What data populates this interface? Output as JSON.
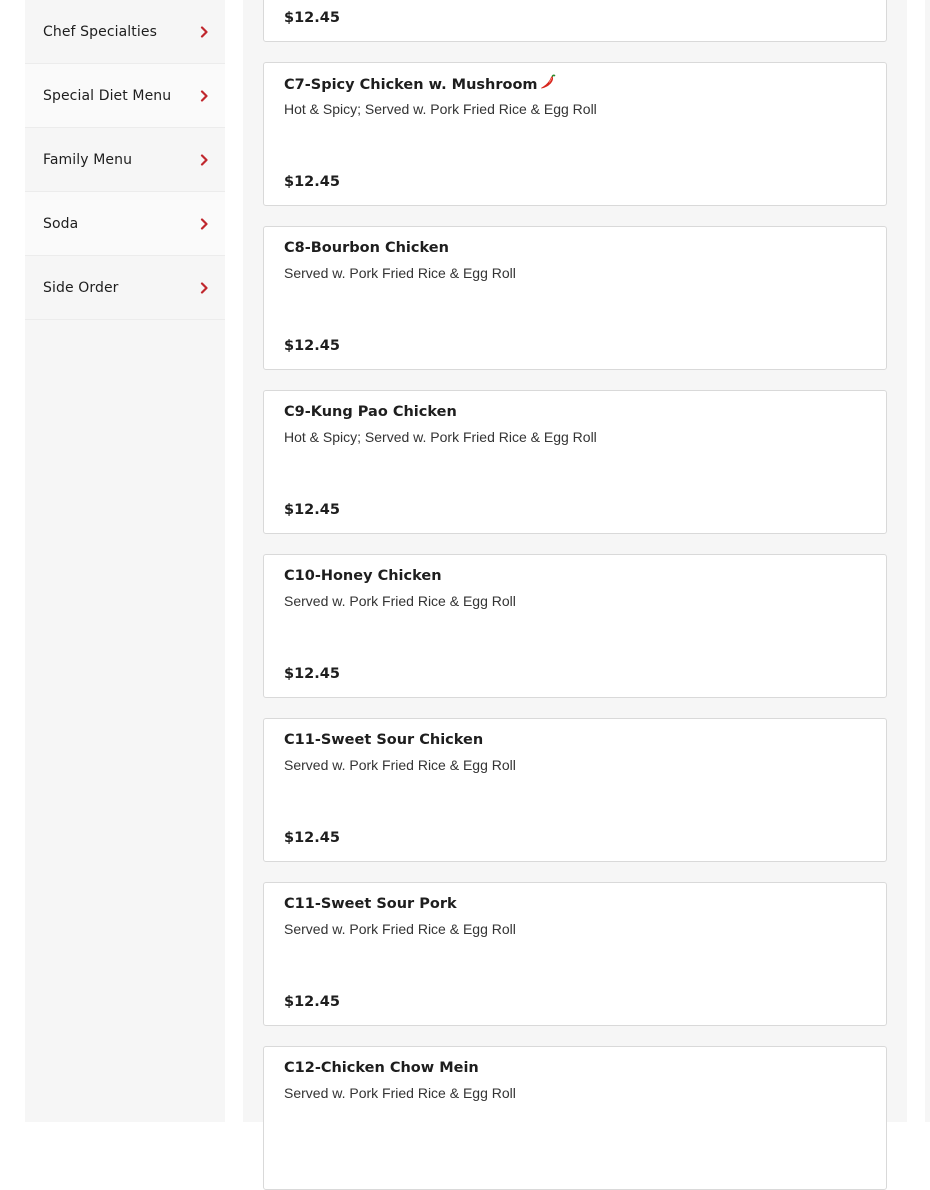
{
  "sidebar": {
    "items": [
      {
        "label": "Chef Specialties"
      },
      {
        "label": "Special Diet Menu"
      },
      {
        "label": "Family Menu"
      },
      {
        "label": "Soda"
      },
      {
        "label": "Side Order"
      }
    ]
  },
  "menu": {
    "top_partial_price": "$12.45",
    "items": [
      {
        "name": "C7-Spicy Chicken w. Mushroom",
        "desc": "Hot & Spicy; Served w. Pork Fried Rice & Egg Roll",
        "price": "$12.45",
        "spicy": true
      },
      {
        "name": "C8-Bourbon Chicken",
        "desc": "Served w. Pork Fried Rice & Egg Roll",
        "price": "$12.45",
        "spicy": false
      },
      {
        "name": "C9-Kung Pao Chicken",
        "desc": "Hot & Spicy; Served w. Pork Fried Rice & Egg Roll",
        "price": "$12.45",
        "spicy": false
      },
      {
        "name": "C10-Honey Chicken",
        "desc": "Served w. Pork Fried Rice & Egg Roll",
        "price": "$12.45",
        "spicy": false
      },
      {
        "name": "C11-Sweet Sour Chicken",
        "desc": "Served w. Pork Fried Rice & Egg Roll",
        "price": "$12.45",
        "spicy": false
      },
      {
        "name": "C11-Sweet Sour Pork",
        "desc": "Served w. Pork Fried Rice & Egg Roll",
        "price": "$12.45",
        "spicy": false
      },
      {
        "name": "C12-Chicken Chow Mein",
        "desc": "Served w. Pork Fried Rice & Egg Roll",
        "price": "",
        "spicy": false
      }
    ]
  },
  "icons": {
    "chevron": "chevron-right-icon",
    "spicy": "chili-pepper-icon"
  },
  "colors": {
    "accent": "#c0272d",
    "pepper": "#d7261e",
    "panel_bg": "#f6f6f6",
    "card_border": "#d9d9d9"
  }
}
